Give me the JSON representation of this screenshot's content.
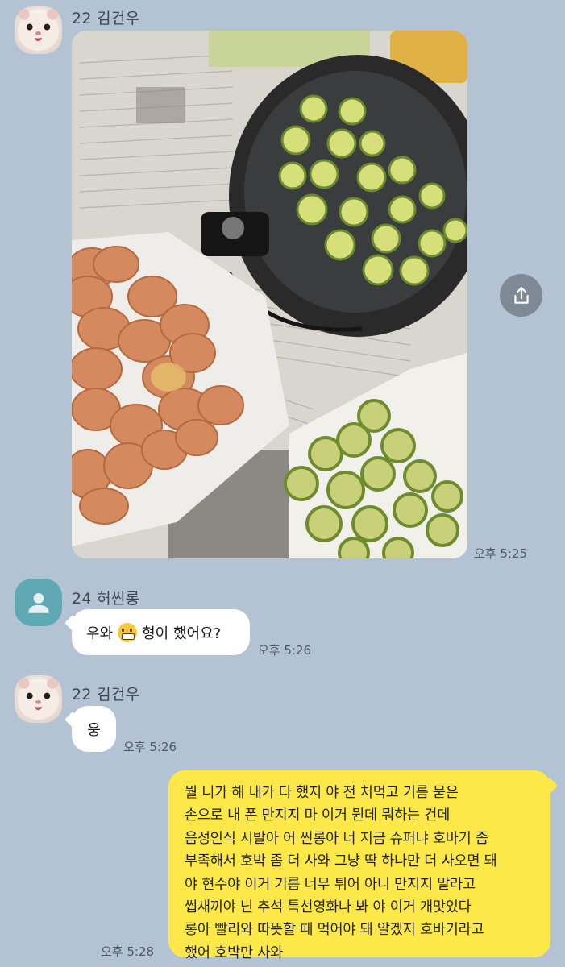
{
  "messages": [
    {
      "sender": "22 김건우",
      "type": "photo",
      "time": "오후 5:25"
    },
    {
      "sender": "24 허씬롱",
      "text_before": "우와",
      "emoji": "grimacing-face",
      "text_after": "형이 했어요?",
      "time": "오후 5:26"
    },
    {
      "sender": "22 김건우",
      "text": "웅",
      "time": "오후 5:26"
    },
    {
      "sender": "me",
      "text": "뭘 니가 해 내가 다 했지 야 전 처먹고 기름 묻은\n손으로 내 폰 만지지 마 이거 뭔데 뭐하는 건데\n음성인식 시발아 어 씬롱아 너 지금 슈퍼냐 호바기 좀\n부족해서 호박 좀 더 사와 그냥 딱 하나만 더 사오면 돼\n야 현수야 이거 기름 너무 튀어 아니 만지지 말라고\n씹새끼야 닌 추석 특선영화나 봐 야 이거 개맛있다\n롱아 빨리와 따뜻할 때 먹어야 돼 알겠지 호바기라고\n했어 호박만 사와",
      "time": "오후 5:28"
    }
  ],
  "icons": {
    "share": "share-icon",
    "default_avatar": "person-icon",
    "emoji": "grimacing-face-emoji"
  },
  "colors": {
    "background": "#b3c3d4",
    "my_bubble": "#fde84a",
    "other_bubble": "#ffffff"
  }
}
